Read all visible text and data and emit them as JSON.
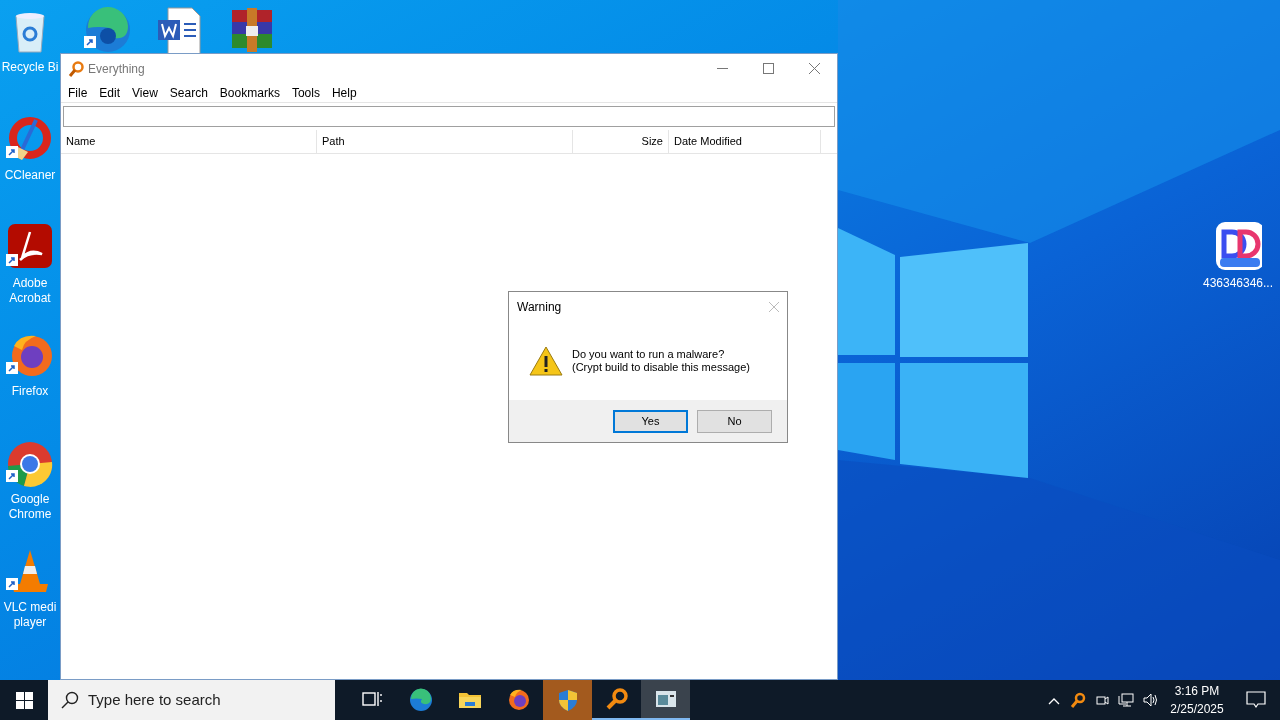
{
  "desktop_left": [
    {
      "kind": "recycle",
      "label": "Recycle Bi",
      "shortcut": false
    },
    {
      "kind": "ccleaner",
      "label": "CCleaner",
      "shortcut": true
    },
    {
      "kind": "acrobat",
      "label": "Adobe Acrobat",
      "shortcut": true
    },
    {
      "kind": "firefox",
      "label": "Firefox",
      "shortcut": true
    },
    {
      "kind": "chrome",
      "label": "Google Chrome",
      "shortcut": true
    },
    {
      "kind": "vlc",
      "label": "VLC medi player",
      "shortcut": true
    }
  ],
  "desktop_top": [
    {
      "kind": "edge",
      "shortcut": true
    },
    {
      "kind": "word",
      "shortcut": false
    },
    {
      "kind": "winrar",
      "shortcut": false
    }
  ],
  "desktop_right": [
    {
      "kind": "dd",
      "label": "436346346...",
      "shortcut": false
    }
  ],
  "window": {
    "title": "Everything",
    "menu": [
      "File",
      "Edit",
      "View",
      "Search",
      "Bookmarks",
      "Tools",
      "Help"
    ],
    "columns": [
      "Name",
      "Path",
      "Size",
      "Date Modified"
    ]
  },
  "dialog": {
    "title": "Warning",
    "message": [
      "Do you want to run a malware?",
      "(Crypt build to disable this message)"
    ],
    "buttons": [
      {
        "label": "Yes",
        "selected": true
      },
      {
        "label": "No",
        "selected": false
      }
    ]
  },
  "taskbar": {
    "search_placeholder": "Type here to search",
    "apps": [
      {
        "kind": "taskview",
        "running": false,
        "flashing": false,
        "selected": false
      },
      {
        "kind": "edge",
        "running": false,
        "flashing": false,
        "selected": false
      },
      {
        "kind": "explorer",
        "running": false,
        "flashing": false,
        "selected": false
      },
      {
        "kind": "firefox",
        "running": false,
        "flashing": false,
        "selected": false
      },
      {
        "kind": "shield",
        "running": false,
        "flashing": true,
        "selected": false
      },
      {
        "kind": "everything",
        "running": true,
        "flashing": false,
        "selected": false
      },
      {
        "kind": "window",
        "running": true,
        "flashing": false,
        "selected": true
      }
    ],
    "tray": [
      {
        "kind": "chevron"
      },
      {
        "kind": "everything"
      },
      {
        "kind": "meet"
      },
      {
        "kind": "network"
      },
      {
        "kind": "volume"
      }
    ],
    "time": "3:16 PM",
    "date": "2/25/2025"
  }
}
